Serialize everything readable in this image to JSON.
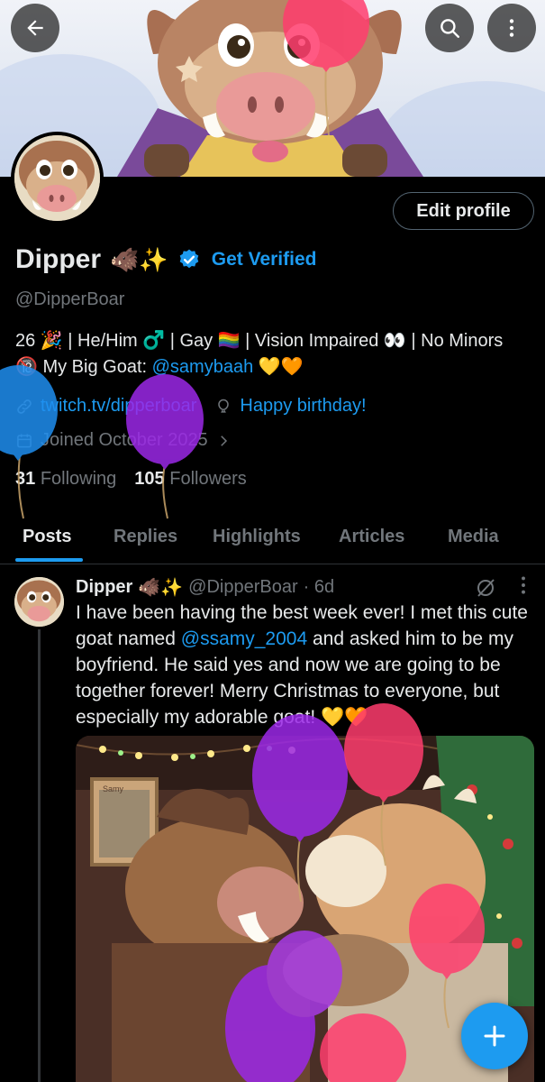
{
  "top_bar": {
    "back_icon": "arrow-left-icon",
    "search_icon": "search-icon",
    "more_icon": "more-vertical-icon"
  },
  "profile": {
    "display_name": "Dipper",
    "name_emoji": "🐗✨",
    "get_verified_label": "Get Verified",
    "handle": "@DipperBoar",
    "edit_profile_label": "Edit profile",
    "bio_line_part1": "26 🎉 | He/Him ♂️ | Gay 🏳️‍🌈 | Vision Impaired 👀 | No Minors 🔞 My Big Goat: ",
    "bio_mention": "@samybaah",
    "bio_suffix": " 💛🧡",
    "website": "twitch.tv/dipperboar",
    "birthday_text": "Happy birthday!",
    "joined_text": "Joined October 2025",
    "following_count": "31",
    "following_label": "Following",
    "followers_count": "105",
    "followers_label": "Followers"
  },
  "tabs": [
    "Posts",
    "Replies",
    "Highlights",
    "Articles",
    "Media"
  ],
  "post": {
    "author_name": "Dipper",
    "author_emoji": "🐗✨",
    "author_handle": "@DipperBoar",
    "time": "· 6d",
    "text_part1": "I have been having the best week ever! I met this cute goat named ",
    "text_mention": "@ssamy_2004",
    "text_part2": " and asked him to be my boyfriend. He said yes and now we are going to be together forever! Merry Christmas to everyone, but especially my adorable goat! 💛🧡",
    "image_label": "Samy"
  },
  "fab_icon": "plus-icon",
  "colors": {
    "accent": "#1d9bf0",
    "background": "#000000",
    "text_primary": "#e7e9ea",
    "text_secondary": "#71767b"
  }
}
